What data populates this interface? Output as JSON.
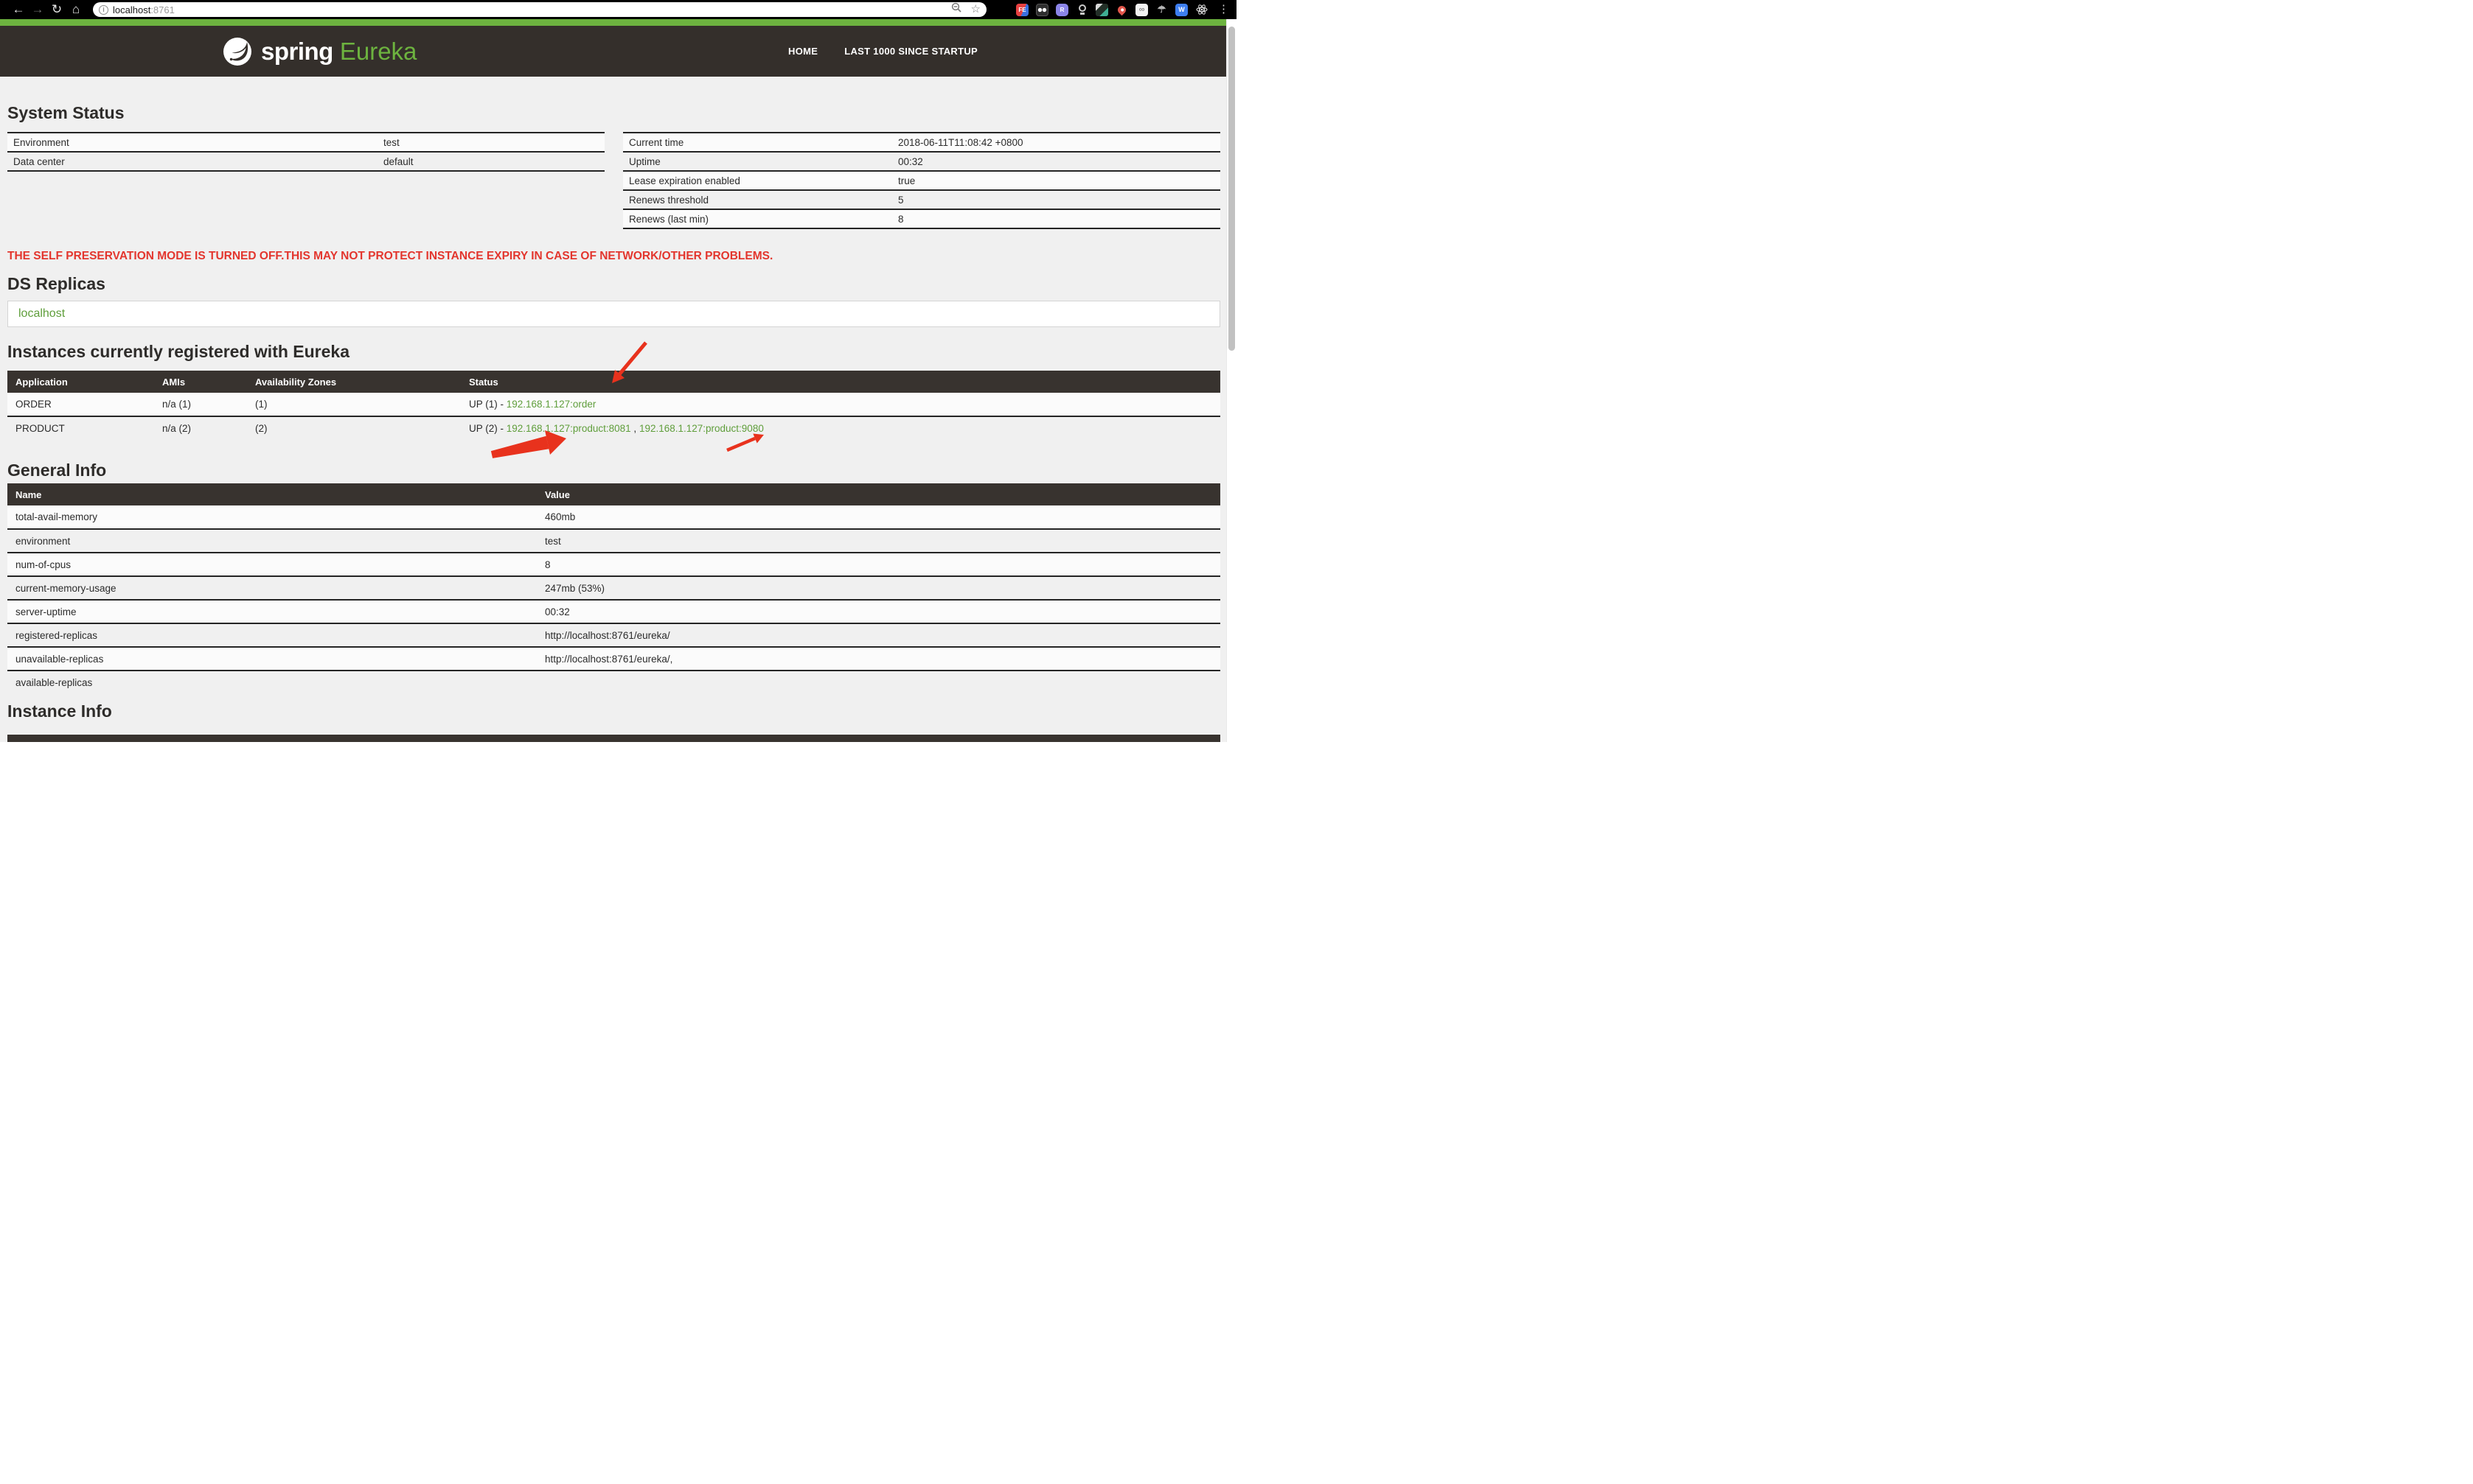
{
  "browser": {
    "url_host": "localhost",
    "url_port": ":8761",
    "extensions": {
      "fe_label": "FE",
      "r_label": "R",
      "w_label": "W"
    }
  },
  "header": {
    "brand_spring": "spring",
    "brand_eureka": "Eureka",
    "nav": {
      "home": "HOME",
      "last1000": "LAST 1000 SINCE STARTUP"
    }
  },
  "system_status": {
    "title": "System Status",
    "left_rows": [
      [
        "Environment",
        "test"
      ],
      [
        "Data center",
        "default"
      ]
    ],
    "right_rows": [
      [
        "Current time",
        "2018-06-11T11:08:42 +0800"
      ],
      [
        "Uptime",
        "00:32"
      ],
      [
        "Lease expiration enabled",
        "true"
      ],
      [
        "Renews threshold",
        "5"
      ],
      [
        "Renews (last min)",
        "8"
      ]
    ]
  },
  "warning": "THE SELF PRESERVATION MODE IS TURNED OFF.THIS MAY NOT PROTECT INSTANCE EXPIRY IN CASE OF NETWORK/OTHER PROBLEMS.",
  "ds_replicas": {
    "title": "DS Replicas",
    "replica": "localhost"
  },
  "instances": {
    "title": "Instances currently registered with Eureka",
    "columns": [
      "Application",
      "AMIs",
      "Availability Zones",
      "Status"
    ],
    "rows": [
      {
        "application": "ORDER",
        "amis": "n/a (1)",
        "zones": "(1)",
        "status_prefix": "UP (1) - ",
        "links": [
          "192.168.1.127:order"
        ],
        "separator": ""
      },
      {
        "application": "PRODUCT",
        "amis": "n/a (2)",
        "zones": "(2)",
        "status_prefix": "UP (2) - ",
        "links": [
          "192.168.1.127:product:8081",
          "192.168.1.127:product:9080"
        ],
        "separator": " , "
      }
    ]
  },
  "general_info": {
    "title": "General Info",
    "columns": [
      "Name",
      "Value"
    ],
    "rows": [
      [
        "total-avail-memory",
        "460mb"
      ],
      [
        "environment",
        "test"
      ],
      [
        "num-of-cpus",
        "8"
      ],
      [
        "current-memory-usage",
        "247mb (53%)"
      ],
      [
        "server-uptime",
        "00:32"
      ],
      [
        "registered-replicas",
        "http://localhost:8761/eureka/"
      ],
      [
        "unavailable-replicas",
        "http://localhost:8761/eureka/,"
      ],
      [
        "available-replicas",
        ""
      ]
    ]
  },
  "instance_info": {
    "title": "Instance Info"
  },
  "colors": {
    "brand_green": "#6db33f",
    "link_green": "#5f9e3b",
    "header_dark": "#342f2b",
    "warning_red": "#e3362e",
    "annotation_red": "#e8321d"
  }
}
